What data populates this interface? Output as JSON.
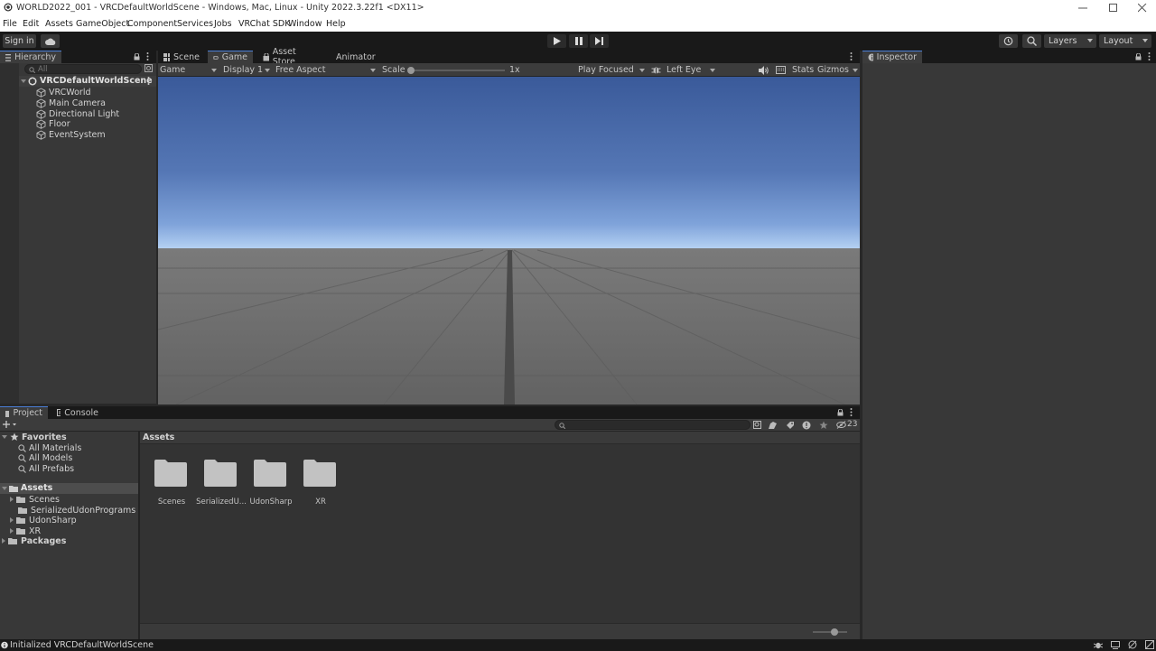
{
  "window": {
    "title": "WORLD2022_001 - VRCDefaultWorldScene - Windows, Mac, Linux - Unity 2022.3.22f1 <DX11>",
    "controls": [
      "minimize-icon",
      "maximize-icon",
      "close-icon"
    ]
  },
  "menu": {
    "file": "File",
    "edit": "Edit",
    "assets": "Assets",
    "gameobject": "GameObject",
    "component": "Component",
    "services": "Services",
    "jobs": "Jobs",
    "vrchat_sdk": "VRChat SDK",
    "window": "Window",
    "help": "Help"
  },
  "toolbar": {
    "sign_in": "Sign in",
    "layers": "Layers",
    "layout": "Layout"
  },
  "hierarchy": {
    "tab": "Hierarchy",
    "search_placeholder": "All",
    "scene": "VRCDefaultWorldScene",
    "items": [
      "VRCWorld",
      "Main Camera",
      "Directional Light",
      "Floor",
      "EventSystem"
    ]
  },
  "center_tabs": {
    "scene": "Scene",
    "game": "Game",
    "asset_store": "Asset Store",
    "animator": "Animator"
  },
  "game_toolbar": {
    "mode": "Game",
    "display": "Display 1",
    "aspect": "Free Aspect",
    "scale_label": "Scale",
    "scale_value": "1x",
    "scale_fraction": 0.0,
    "play_focus": "Play Focused",
    "eye": "Left Eye",
    "stats": "Stats",
    "gizmos": "Gizmos"
  },
  "inspector": {
    "tab": "Inspector"
  },
  "bottom_tabs": {
    "project": "Project",
    "console": "Console"
  },
  "project": {
    "hidden_count": "23",
    "favorites": {
      "label": "Favorites",
      "items": [
        "All Materials",
        "All Models",
        "All Prefabs"
      ]
    },
    "assets_root": "Assets",
    "asset_folders": [
      "Scenes",
      "SerializedUdonPrograms",
      "UdonSharp",
      "XR"
    ],
    "packages": "Packages",
    "breadcrumb": "Assets",
    "grid_items": [
      "Scenes",
      "SerializedU...",
      "UdonSharp",
      "XR"
    ]
  },
  "status": {
    "message": "Initialized VRCDefaultWorldScene"
  },
  "colors": {
    "accent": "#4a7fd8",
    "panel": "#383838",
    "toolbar": "#191919",
    "sky_top": "#3a5a9a",
    "horizon": "#a8c8ee",
    "floor": "#6a6a6a"
  }
}
